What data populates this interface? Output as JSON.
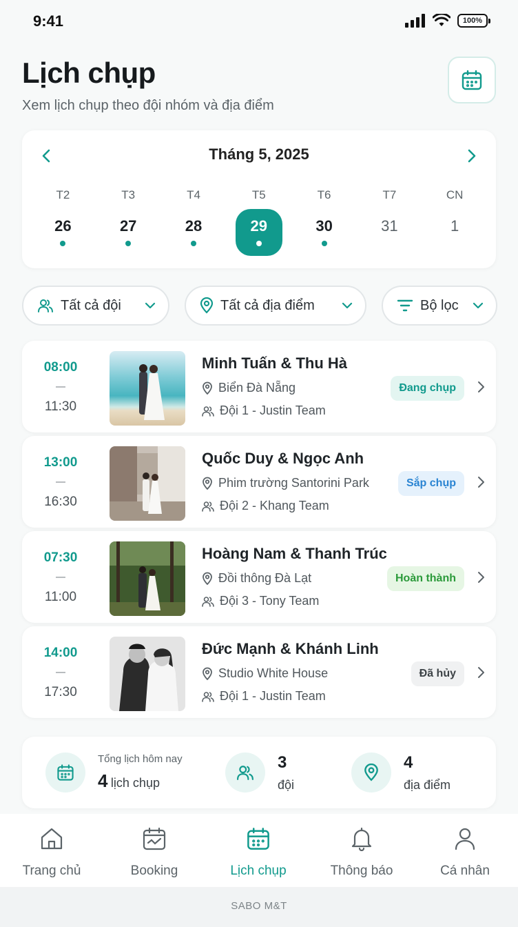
{
  "status_bar": {
    "time": "9:41",
    "battery": "100%"
  },
  "header": {
    "title": "Lịch chụp",
    "subtitle": "Xem lịch chụp theo đội nhóm và địa điểm",
    "calendar_button_icon": "calendar-icon"
  },
  "calendar": {
    "month_label": "Tháng 5, 2025",
    "days": [
      {
        "weekday": "T2",
        "date": "26",
        "has_event": true,
        "selected": false
      },
      {
        "weekday": "T3",
        "date": "27",
        "has_event": true,
        "selected": false
      },
      {
        "weekday": "T4",
        "date": "28",
        "has_event": true,
        "selected": false
      },
      {
        "weekday": "T5",
        "date": "29",
        "has_event": true,
        "selected": true
      },
      {
        "weekday": "T6",
        "date": "30",
        "has_event": true,
        "selected": false
      },
      {
        "weekday": "T7",
        "date": "31",
        "has_event": false,
        "selected": false
      },
      {
        "weekday": "CN",
        "date": "1",
        "has_event": false,
        "selected": false
      }
    ]
  },
  "filters": {
    "team": "Tất cả đội",
    "location": "Tất cả địa điểm",
    "more": "Bộ lọc"
  },
  "bookings": [
    {
      "start": "08:00",
      "end": "11:30",
      "couple": "Minh Tuấn & Thu Hà",
      "location": "Biển Đà Nẵng",
      "team": "Đội 1 - Justin Team",
      "status": "Đang chụp",
      "status_bg": "#e3f5f1",
      "status_color": "#119a8d"
    },
    {
      "start": "13:00",
      "end": "16:30",
      "couple": "Quốc Duy & Ngọc Anh",
      "location": "Phim trường Santorini Park",
      "team": "Đội 2 - Khang Team",
      "status": "Sắp chụp",
      "status_bg": "#e5f1fc",
      "status_color": "#2a84d2"
    },
    {
      "start": "07:30",
      "end": "11:00",
      "couple": "Hoàng Nam & Thanh Trúc",
      "location": "Đồi thông Đà Lạt",
      "team": "Đội 3 - Tony Team",
      "status": "Hoàn thành",
      "status_bg": "#e6f6e4",
      "status_color": "#2b9a3a"
    },
    {
      "start": "14:00",
      "end": "17:30",
      "couple": "Đức Mạnh & Khánh Linh",
      "location": "Studio White House",
      "team": "Đội 1 - Justin Team",
      "status": "Đã hủy",
      "status_bg": "#f0f1f2",
      "status_color": "#3c4246"
    }
  ],
  "summary": {
    "today_label": "Tổng lịch hôm nay",
    "today_count": "4",
    "today_unit": "lịch chụp",
    "teams_count": "3",
    "teams_unit": "đội",
    "locations_count": "4",
    "locations_unit": "địa điểm"
  },
  "tabs": [
    {
      "label": "Trang chủ",
      "icon": "home-icon",
      "active": false
    },
    {
      "label": "Booking",
      "icon": "booking-icon",
      "active": false
    },
    {
      "label": "Lịch chụp",
      "icon": "calendar-icon",
      "active": true
    },
    {
      "label": "Thông báo",
      "icon": "bell-icon",
      "active": false
    },
    {
      "label": "Cá nhân",
      "icon": "user-icon",
      "active": false
    }
  ],
  "footer": "SABO M&T",
  "colors": {
    "accent": "#119a8d"
  }
}
